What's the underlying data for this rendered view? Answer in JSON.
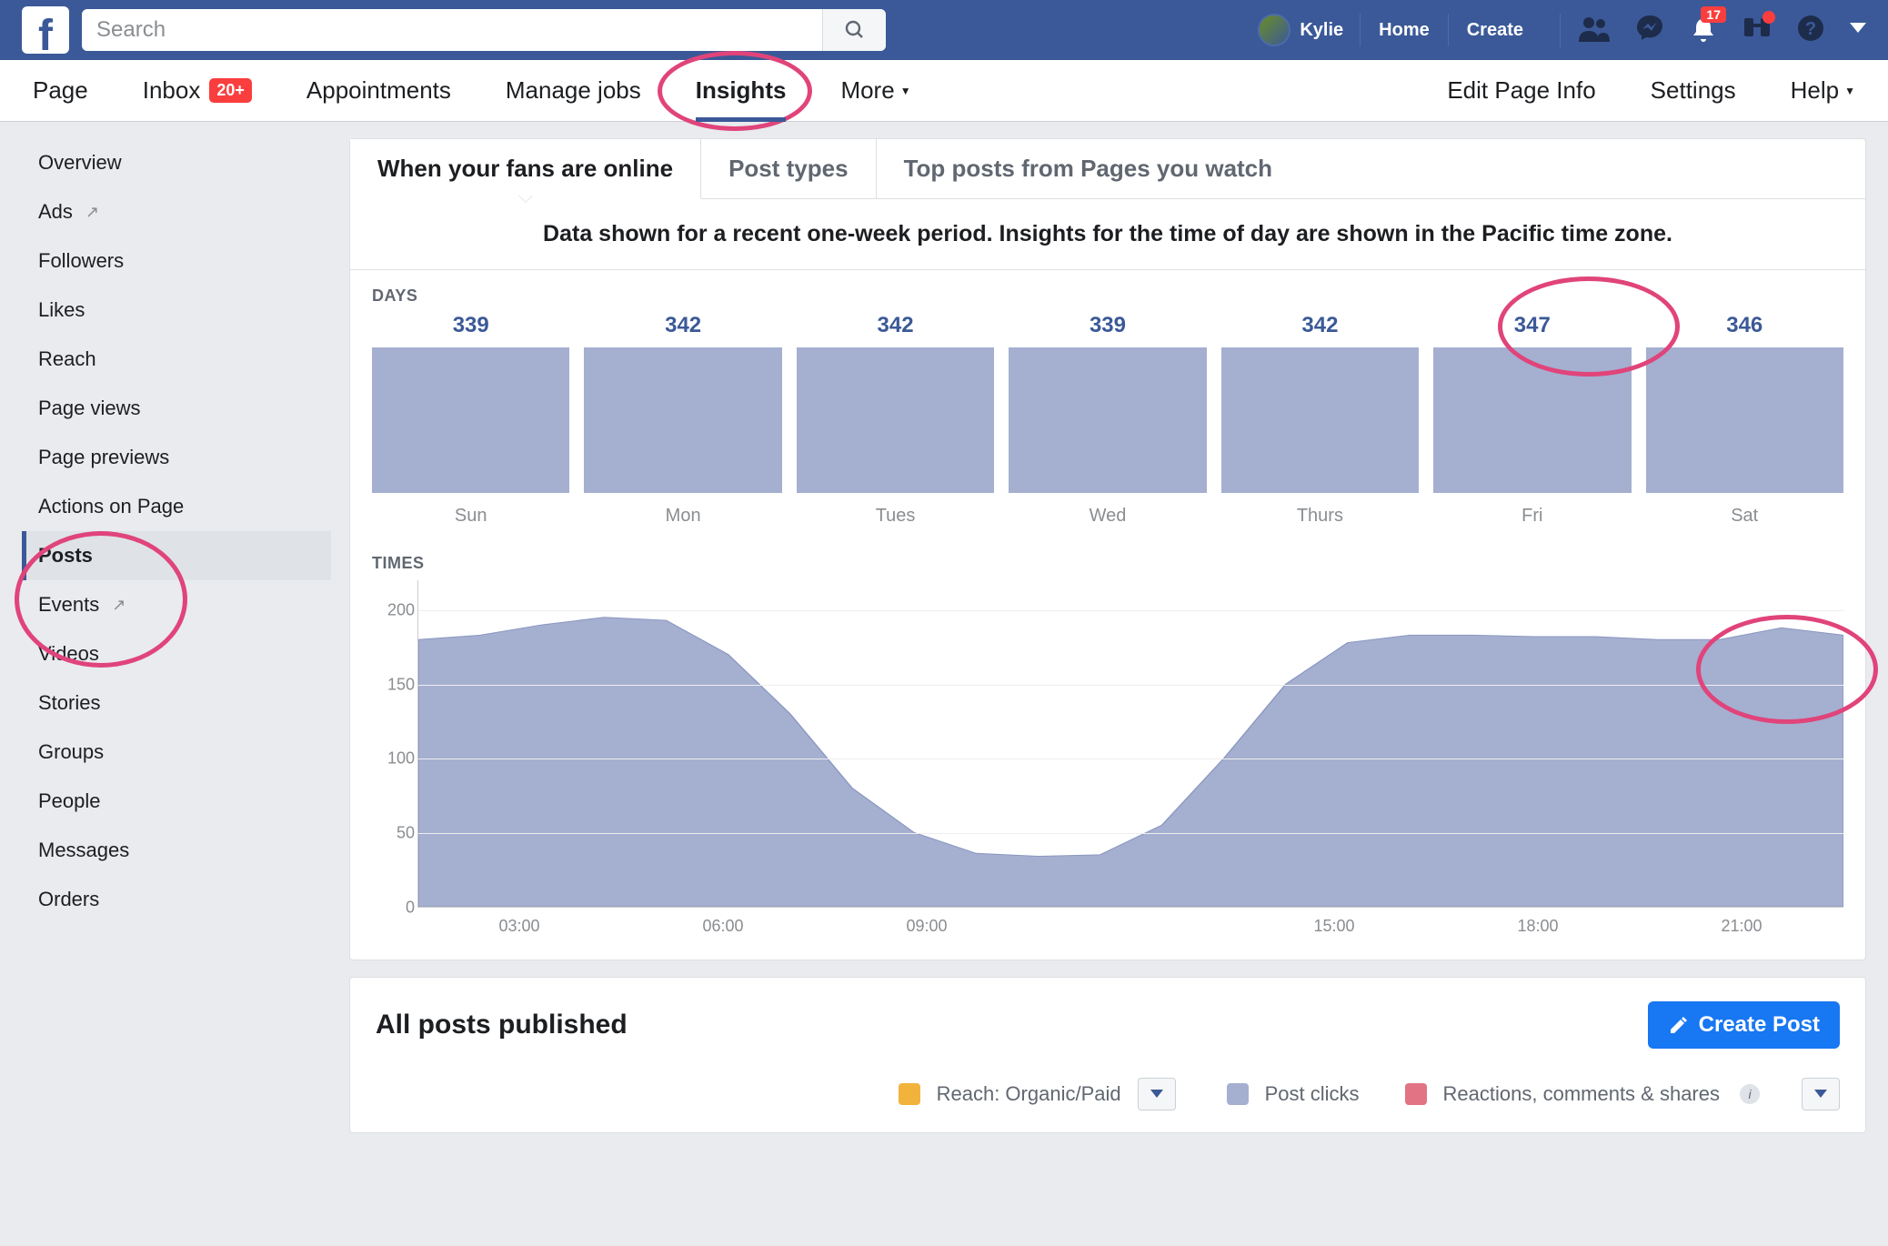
{
  "topbar": {
    "search_placeholder": "Search",
    "user_name": "Kylie",
    "home": "Home",
    "create": "Create",
    "notif_badge": "17"
  },
  "pagetabs": {
    "page": "Page",
    "inbox": "Inbox",
    "inbox_badge": "20+",
    "appointments": "Appointments",
    "manage_jobs": "Manage jobs",
    "insights": "Insights",
    "more": "More",
    "edit_info": "Edit Page Info",
    "settings": "Settings",
    "help": "Help"
  },
  "sidebar": {
    "items": [
      "Overview",
      "Ads",
      "Followers",
      "Likes",
      "Reach",
      "Page views",
      "Page previews",
      "Actions on Page",
      "Posts",
      "Events",
      "Videos",
      "Stories",
      "Groups",
      "People",
      "Messages",
      "Orders"
    ]
  },
  "contentTabs": {
    "t1": "When your fans are online",
    "t2": "Post types",
    "t3": "Top posts from Pages you watch"
  },
  "subheading": "Data shown for a recent one-week period. Insights for the time of day are shown in the Pacific time zone.",
  "daysLabel": "DAYS",
  "timesLabel": "TIMES",
  "allPosts": {
    "title": "All posts published",
    "create": "Create Post",
    "legend": {
      "reach": "Reach: Organic/Paid",
      "clicks": "Post clicks",
      "reactions": "Reactions, comments & shares"
    }
  },
  "chart_data": [
    {
      "type": "bar",
      "title": "DAYS",
      "categories": [
        "Sun",
        "Mon",
        "Tues",
        "Wed",
        "Thurs",
        "Fri",
        "Sat"
      ],
      "values": [
        339,
        342,
        342,
        339,
        342,
        347,
        346
      ]
    },
    {
      "type": "area",
      "title": "TIMES",
      "ylabel": "",
      "ylim": [
        0,
        220
      ],
      "yticks": [
        0,
        50,
        100,
        150,
        200
      ],
      "xlabels_shown": [
        "03:00",
        "06:00",
        "09:00",
        "",
        "15:00",
        "18:00",
        "21:00"
      ],
      "x_hours": [
        0,
        1,
        2,
        3,
        4,
        5,
        6,
        7,
        8,
        9,
        10,
        11,
        12,
        13,
        14,
        15,
        16,
        17,
        18,
        19,
        20,
        21,
        22,
        23
      ],
      "values": [
        180,
        183,
        190,
        195,
        193,
        170,
        130,
        80,
        50,
        36,
        34,
        35,
        55,
        100,
        150,
        178,
        183,
        183,
        182,
        182,
        180,
        180,
        188,
        183
      ]
    }
  ]
}
